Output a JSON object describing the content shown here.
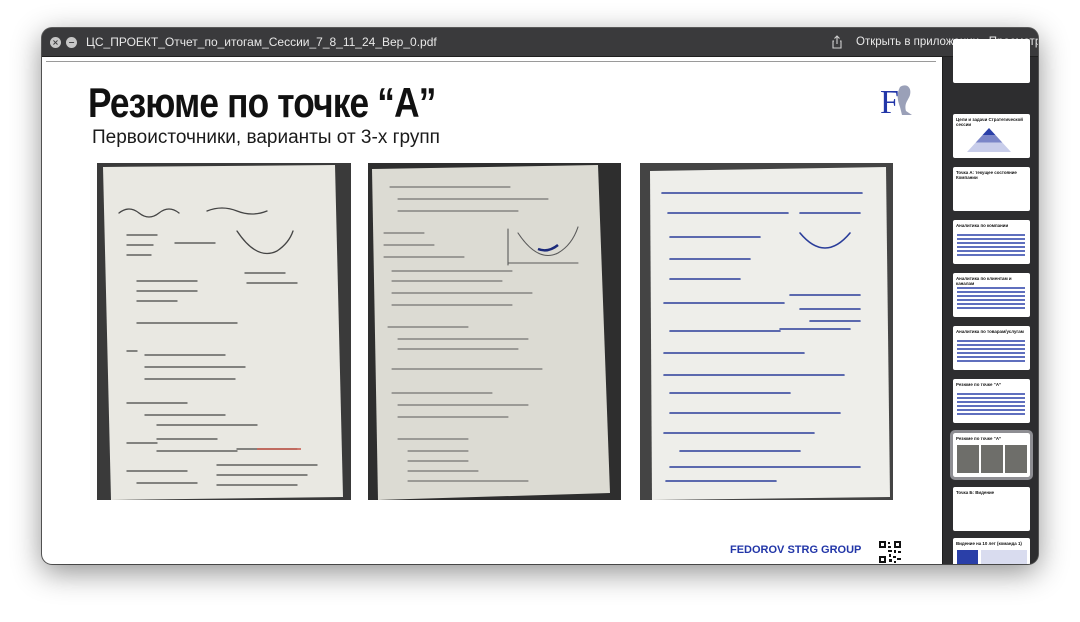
{
  "window": {
    "title": "ЦС_ПРОЕКТ_Отчет_по_итогам_Сессии_7_8_11_24_Вер_0.pdf",
    "open_in_app": "Открыть в приложении «Просмотр»",
    "close_icon": "close-icon",
    "minimize_icon": "minimize-icon",
    "share_icon": "share-icon"
  },
  "slide": {
    "title": "Резюме по точке “А”",
    "subtitle": "Первоисточники, варианты от 3-х групп",
    "brand": "FEDOROV STRG GROUP",
    "photos": [
      {
        "name": "photo-group-1",
        "label": "handwritten flipchart sheet"
      },
      {
        "name": "photo-group-2",
        "label": "handwritten flipchart sheet"
      },
      {
        "name": "photo-group-3",
        "label": "handwritten flipchart sheet"
      }
    ]
  },
  "sidebar": {
    "thumbnails": [
      {
        "title": "",
        "active": false
      },
      {
        "title": "Цели и задачи Стратегической сессии",
        "active": false
      },
      {
        "title": "Точка А: текущее состояние Компании",
        "active": false
      },
      {
        "title": "Аналитика по компании",
        "active": false
      },
      {
        "title": "Аналитика по клиентам и каналам",
        "active": false
      },
      {
        "title": "Аналитика по товарам/услугам",
        "active": false
      },
      {
        "title": "Резюме по точке “А”",
        "active": false
      },
      {
        "title": "Резюме по точке “А”",
        "active": true
      },
      {
        "title": "Точка Б: Видение",
        "active": false
      },
      {
        "title": "Видение на 10 лет (команда 1)",
        "active": false
      }
    ]
  }
}
